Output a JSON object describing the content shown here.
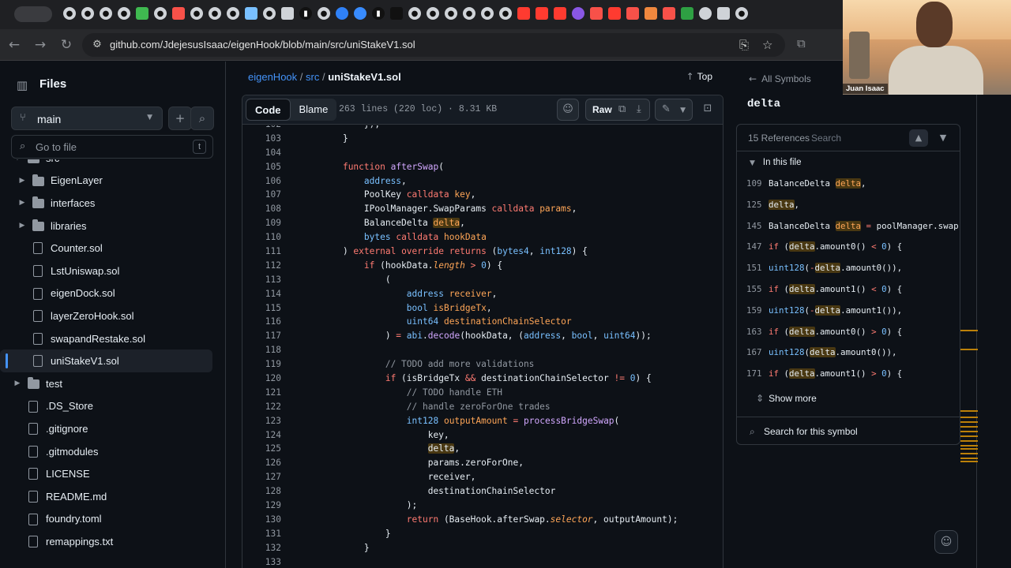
{
  "browser": {
    "url": "github.com/JdejesusIsaac/eigenHook/blob/main/src/uniStakeV1.sol"
  },
  "sidebar": {
    "title": "Files",
    "branch": "main",
    "goto_placeholder": "Go to file",
    "goto_shortcut": "t",
    "items": [
      {
        "label": "src",
        "type": "folder",
        "depth": 0,
        "expanded": true
      },
      {
        "label": "EigenLayer",
        "type": "folder",
        "depth": 1,
        "expanded": false
      },
      {
        "label": "interfaces",
        "type": "folder",
        "depth": 1,
        "expanded": false
      },
      {
        "label": "libraries",
        "type": "folder",
        "depth": 1,
        "expanded": false
      },
      {
        "label": "Counter.sol",
        "type": "file",
        "depth": 1
      },
      {
        "label": "LstUniswap.sol",
        "type": "file",
        "depth": 1
      },
      {
        "label": "eigenDock.sol",
        "type": "file",
        "depth": 1
      },
      {
        "label": "layerZeroHook.sol",
        "type": "file",
        "depth": 1
      },
      {
        "label": "swapandRestake.sol",
        "type": "file",
        "depth": 1
      },
      {
        "label": "uniStakeV1.sol",
        "type": "file",
        "depth": 1,
        "selected": true
      },
      {
        "label": "test",
        "type": "folder",
        "depth": 0,
        "expanded": false
      },
      {
        "label": ".DS_Store",
        "type": "file",
        "depth": 0
      },
      {
        "label": ".gitignore",
        "type": "file",
        "depth": 0
      },
      {
        "label": ".gitmodules",
        "type": "file",
        "depth": 0
      },
      {
        "label": "LICENSE",
        "type": "file",
        "depth": 0
      },
      {
        "label": "README.md",
        "type": "file",
        "depth": 0
      },
      {
        "label": "foundry.toml",
        "type": "file",
        "depth": 0
      },
      {
        "label": "remappings.txt",
        "type": "file",
        "depth": 0
      }
    ]
  },
  "breadcrumb": {
    "repo": "eigenHook",
    "folder": "src",
    "file": "uniStakeV1.sol",
    "top_label": "Top"
  },
  "file_header": {
    "tab_code": "Code",
    "tab_blame": "Blame",
    "meta": "263 lines (220 loc) · 8.31 KB",
    "raw_label": "Raw"
  },
  "code": {
    "lines": [
      {
        "n": "102",
        "html": "        });"
      },
      {
        "n": "103",
        "html": "    }"
      },
      {
        "n": "104",
        "html": ""
      },
      {
        "n": "105",
        "html": "    <span class=\"kw\">function</span> <span class=\"fn\">afterSwap</span>("
      },
      {
        "n": "106",
        "html": "        <span class=\"ty\">address</span>,"
      },
      {
        "n": "107",
        "html": "        PoolKey <span class=\"kw\">calldata</span> <span class=\"nm\">key</span>,"
      },
      {
        "n": "108",
        "html": "        IPoolManager.SwapParams <span class=\"kw\">calldata</span> <span class=\"nm\">params</span>,"
      },
      {
        "n": "109",
        "html": "        BalanceDelta <span class=\"nm hl\">delta</span>,"
      },
      {
        "n": "110",
        "html": "        <span class=\"ty\">bytes</span> <span class=\"kw\">calldata</span> <span class=\"nm\">hookData</span>"
      },
      {
        "n": "111",
        "html": "    ) <span class=\"kw\">external</span> <span class=\"kw\">override</span> <span class=\"kw\">returns</span> (<span class=\"ty\">bytes4</span>, <span class=\"ty\">int128</span>) {"
      },
      {
        "n": "112",
        "html": "        <span class=\"kw\">if</span> (hookData.<span class=\"it\">length</span> <span class=\"kw\">&gt;</span> <span class=\"ty\">0</span>) {"
      },
      {
        "n": "113",
        "html": "            ("
      },
      {
        "n": "114",
        "html": "                <span class=\"ty\">address</span> <span class=\"nm\">receiver</span>,"
      },
      {
        "n": "115",
        "html": "                <span class=\"ty\">bool</span> <span class=\"nm\">isBridgeTx</span>,"
      },
      {
        "n": "116",
        "html": "                <span class=\"ty\">uint64</span> <span class=\"nm\">destinationChainSelector</span>"
      },
      {
        "n": "117",
        "html": "            ) <span class=\"kw\">=</span> <span class=\"ty\">abi</span>.<span class=\"fn\">decode</span>(hookData, (<span class=\"ty\">address</span>, <span class=\"ty\">bool</span>, <span class=\"ty\">uint64</span>));"
      },
      {
        "n": "118",
        "html": ""
      },
      {
        "n": "119",
        "html": "            <span class=\"cm\">// TODO add more validations</span>"
      },
      {
        "n": "120",
        "html": "            <span class=\"kw\">if</span> (isBridgeTx <span class=\"kw\">&amp;&amp;</span> destinationChainSelector <span class=\"kw\">!=</span> <span class=\"ty\">0</span>) {"
      },
      {
        "n": "121",
        "html": "                <span class=\"cm\">// TODO handle ETH</span>"
      },
      {
        "n": "122",
        "html": "                <span class=\"cm\">// handle zeroForOne trades</span>"
      },
      {
        "n": "123",
        "html": "                <span class=\"ty\">int128</span> <span class=\"nm\">outputAmount</span> <span class=\"kw\">=</span> <span class=\"fn\">processBridgeSwap</span>("
      },
      {
        "n": "124",
        "html": "                    key,"
      },
      {
        "n": "125",
        "html": "                    <span class=\"hl\">delta</span>,"
      },
      {
        "n": "126",
        "html": "                    params.zeroForOne,"
      },
      {
        "n": "127",
        "html": "                    receiver,"
      },
      {
        "n": "128",
        "html": "                    destinationChainSelector"
      },
      {
        "n": "129",
        "html": "                );"
      },
      {
        "n": "130",
        "html": "                <span class=\"kw\">return</span> (BaseHook.afterSwap.<span class=\"it\">selector</span>, outputAmount);"
      },
      {
        "n": "131",
        "html": "            }"
      },
      {
        "n": "132",
        "html": "        }"
      },
      {
        "n": "133",
        "html": ""
      }
    ]
  },
  "symbols": {
    "back_label": "All Symbols",
    "symbol": "delta",
    "ref_count": "15 References",
    "search_placeholder": "Search",
    "section_label": "In this file",
    "refs": [
      {
        "n": "109",
        "html": "BalanceDelta <span class=\"nm hl\">delta</span>,"
      },
      {
        "n": "125",
        "html": "<span class=\"hl\">delta</span>,"
      },
      {
        "n": "145",
        "html": "BalanceDelta <span class=\"nm hl\">delta</span> <span class=\"kw\">=</span> poolManager.swap"
      },
      {
        "n": "147",
        "html": "<span class=\"kw\">if</span> (<span class=\"hl\">delta</span>.amount0() <span class=\"kw\">&lt;</span> <span class=\"ty\">0</span>) {"
      },
      {
        "n": "151",
        "html": "<span class=\"ty\">uint128</span>(<span class=\"kw\">-</span><span class=\"hl\">delta</span>.amount0()),"
      },
      {
        "n": "155",
        "html": "<span class=\"kw\">if</span> (<span class=\"hl\">delta</span>.amount1() <span class=\"kw\">&lt;</span> <span class=\"ty\">0</span>) {"
      },
      {
        "n": "159",
        "html": "<span class=\"ty\">uint128</span>(<span class=\"kw\">-</span><span class=\"hl\">delta</span>.amount1()),"
      },
      {
        "n": "163",
        "html": "<span class=\"kw\">if</span> (<span class=\"hl\">delta</span>.amount0() <span class=\"kw\">&gt;</span> <span class=\"ty\">0</span>) {"
      },
      {
        "n": "167",
        "html": "<span class=\"ty\">uint128</span>(<span class=\"hl\">delta</span>.amount0()),"
      },
      {
        "n": "171",
        "html": "<span class=\"kw\">if</span> (<span class=\"hl\">delta</span>.amount1() <span class=\"kw\">&gt;</span> <span class=\"ty\">0</span>) {"
      }
    ],
    "show_more": "Show more",
    "search_symbol": "Search for this symbol"
  },
  "webcam": {
    "name": "Juan Isaac"
  },
  "colors": {
    "accent": "#4493f8",
    "highlight": "#bb8009",
    "background": "#0d1117"
  }
}
